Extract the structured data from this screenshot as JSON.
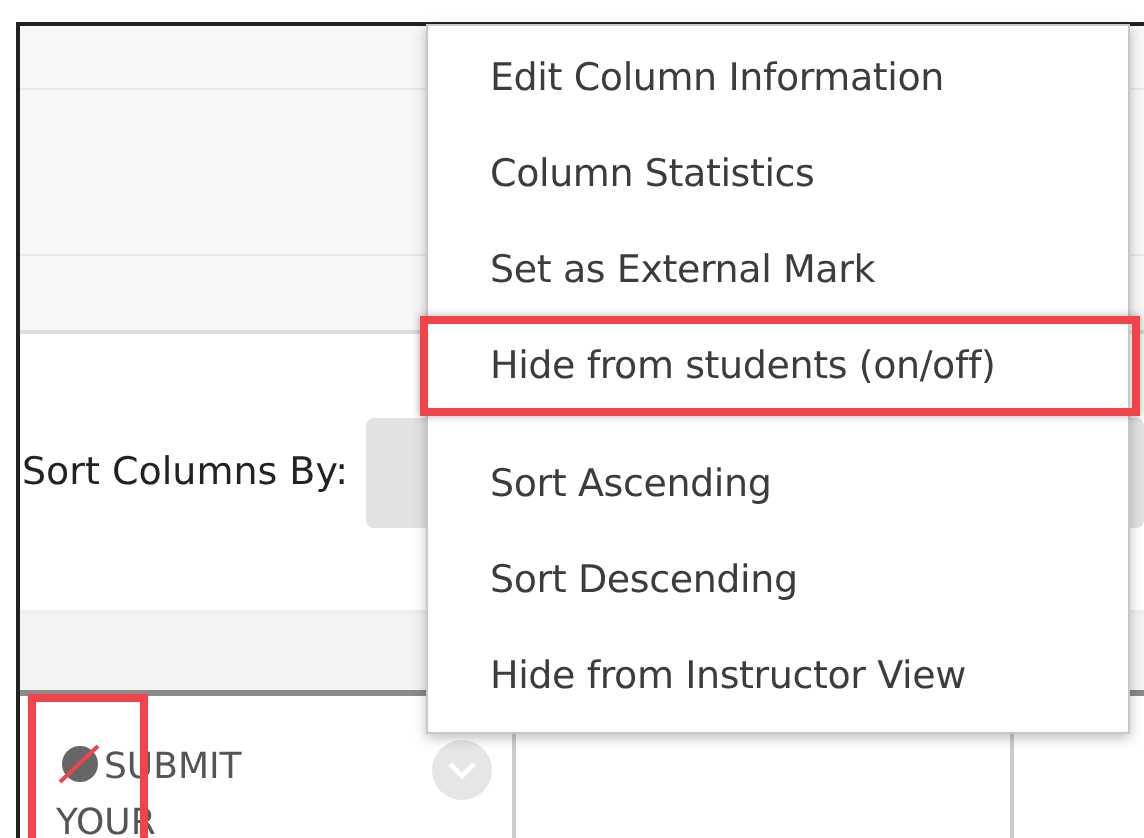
{
  "sort": {
    "label": "Sort Columns By:"
  },
  "column_header": {
    "label": "SUBMIT YOUR",
    "hidden": true,
    "highlighted": true
  },
  "menu": {
    "groups": [
      [
        {
          "label": "Edit Column Information",
          "highlighted": false
        },
        {
          "label": "Column Statistics",
          "highlighted": false
        },
        {
          "label": "Set as External Mark",
          "highlighted": false
        },
        {
          "label": "Hide from students (on/off)",
          "highlighted": true
        }
      ],
      [
        {
          "label": "Sort Ascending",
          "highlighted": false
        },
        {
          "label": "Sort Descending",
          "highlighted": false
        },
        {
          "label": "Hide from Instructor View",
          "highlighted": false
        }
      ]
    ]
  }
}
